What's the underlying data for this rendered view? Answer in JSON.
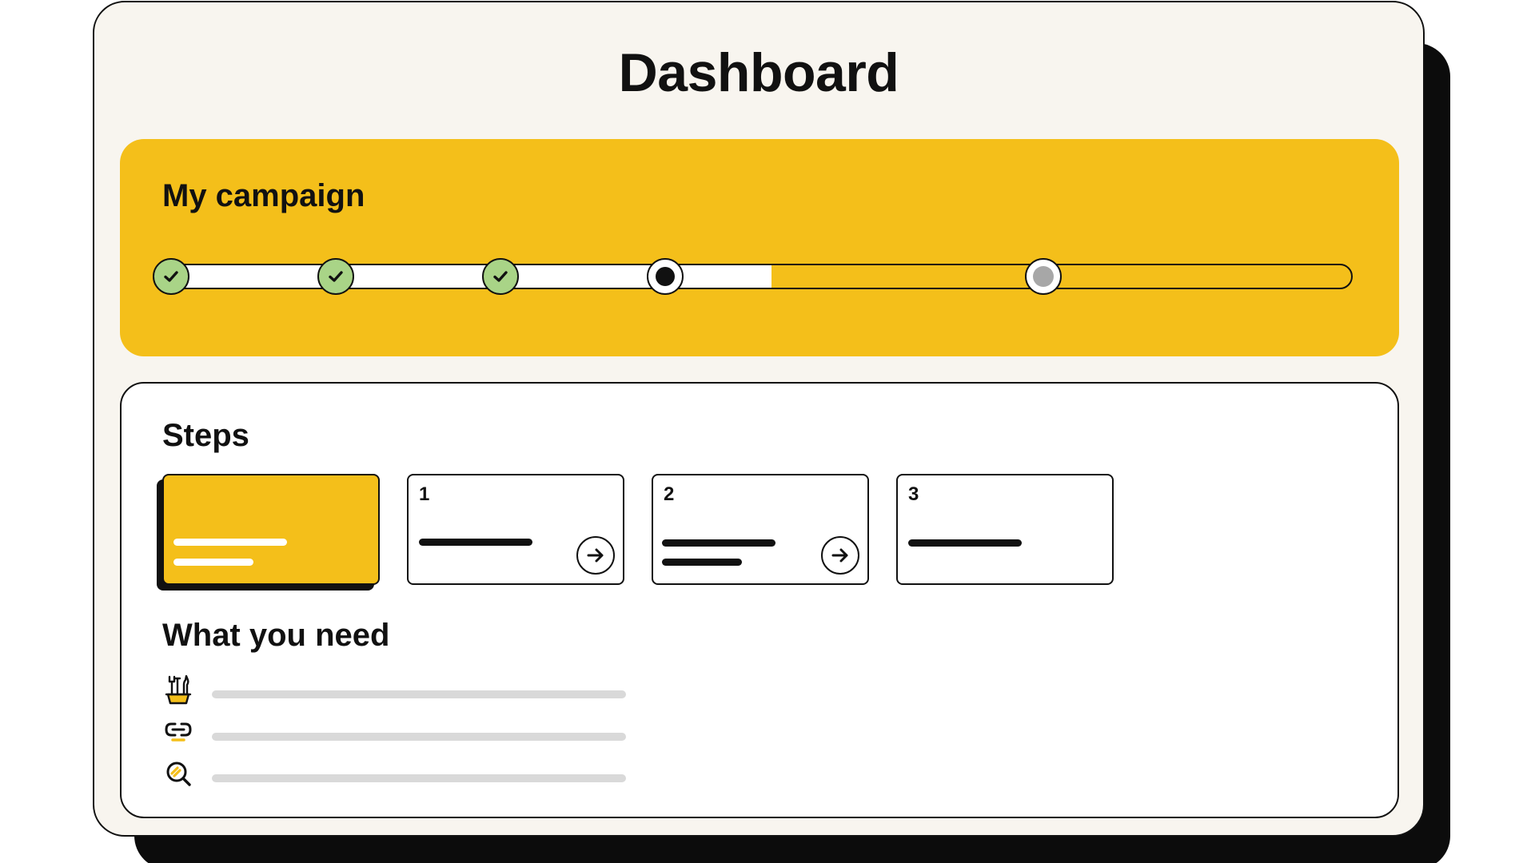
{
  "header": {
    "title": "Dashboard"
  },
  "campaign": {
    "title": "My campaign",
    "progress": 0.51,
    "milestones": [
      {
        "state": "done",
        "icon": "check-icon"
      },
      {
        "state": "done",
        "icon": "check-icon"
      },
      {
        "state": "done",
        "icon": "check-icon"
      },
      {
        "state": "current",
        "icon": "current-dot-icon"
      },
      {
        "state": "upcoming",
        "icon": "upcoming-dot-icon"
      }
    ]
  },
  "steps": {
    "title": "Steps",
    "items": [
      {
        "number": "",
        "state": "active"
      },
      {
        "number": "1",
        "state": "todo",
        "icon": "arrow-right-icon"
      },
      {
        "number": "2",
        "state": "todo",
        "icon": "arrow-right-icon"
      },
      {
        "number": "3",
        "state": "todo"
      }
    ]
  },
  "needs": {
    "title": "What you need",
    "items": [
      {
        "icon": "tools-icon"
      },
      {
        "icon": "link-icon"
      },
      {
        "icon": "magnifier-icon"
      }
    ]
  },
  "colors": {
    "accent": "#f4bf1a",
    "done": "#a9d487",
    "background": "#f8f5ef",
    "placeholder": "#d9d9d9",
    "ink": "#111111"
  }
}
